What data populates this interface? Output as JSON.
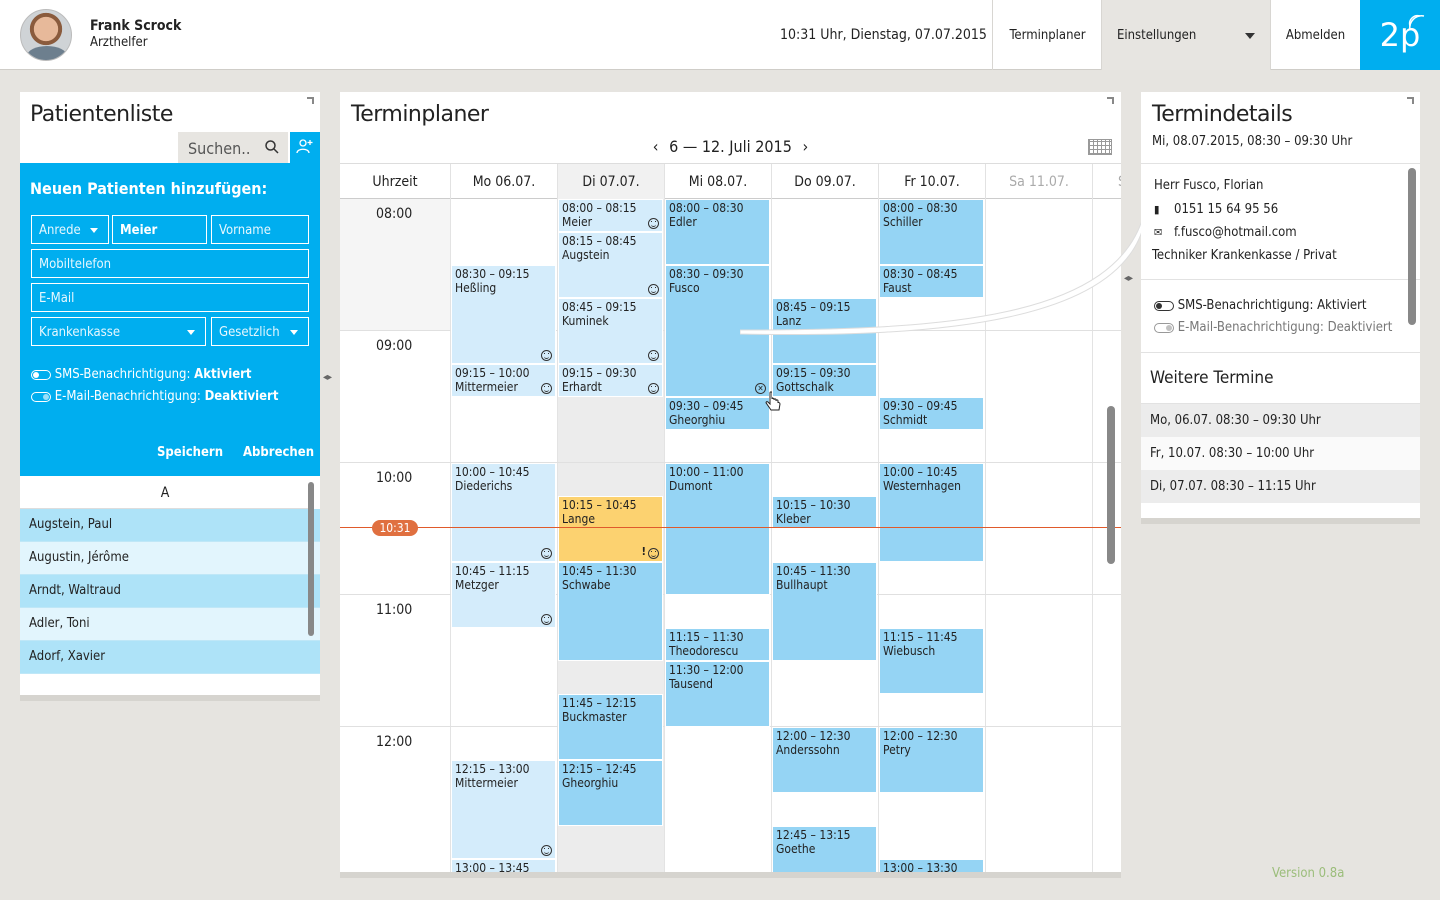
{
  "header": {
    "user_name": "Frank Scrock",
    "user_role": "Arzthelfer",
    "datetime": "10:31 Uhr, Dienstag, 07.07.2015",
    "nav_planner": "Terminplaner",
    "nav_settings": "Einstellungen",
    "nav_logout": "Abmelden",
    "logo": "2p"
  },
  "patient_list": {
    "title": "Patientenliste",
    "search_placeholder": "Suchen..",
    "add_icon": "add-user-icon",
    "form": {
      "title": "Neuen Patienten hinzufügen:",
      "salutation": "Anrede",
      "last_name": "Meier",
      "first_name": "Vorname",
      "mobile": "Mobiltelefon",
      "email": "E-Mail",
      "insurance": "Krankenkasse",
      "insurance_type": "Gesetzlich",
      "sms_label": "SMS-Benachrichtigung:",
      "sms_state": "Aktiviert",
      "email_label": "E-Mail-Benachrichtigung:",
      "email_state": "Deaktiviert",
      "save": "Speichern",
      "cancel": "Abbrechen"
    },
    "letter": "A",
    "patients": [
      "Augstein, Paul",
      "Augustin, Jérôme",
      "Arndt, Waltraud",
      "Adler, Toni",
      "Adorf, Xavier"
    ]
  },
  "planner": {
    "title": "Terminplaner",
    "week_label": "6 — 12. Juli 2015",
    "prev": "‹",
    "next": "›",
    "time_header": "Uhrzeit",
    "days": [
      "Mo 06.07.",
      "Di 07.07.",
      "Mi 08.07.",
      "Do 09.07.",
      "Fr 10.07.",
      "Sa 11.07.",
      "S"
    ],
    "hours": [
      "08:00",
      "09:00",
      "10:00",
      "11:00",
      "12:00"
    ],
    "now": "10:31",
    "appointments": {
      "mo": [
        {
          "time": "08:30 – 09:15",
          "name": "Heßling"
        },
        {
          "time": "09:15 – 10:00",
          "name": "Mittermeier"
        },
        {
          "time": "10:00 – 10:45",
          "name": "Diederichs"
        },
        {
          "time": "10:45 – 11:15",
          "name": "Metzger"
        },
        {
          "time": "12:15 – 13:00",
          "name": "Mittermeier"
        },
        {
          "time": "13:00 – 13:45",
          "name": ""
        }
      ],
      "di": [
        {
          "time": "08:00 – 08:15",
          "name": "Meier"
        },
        {
          "time": "08:15 – 08:45",
          "name": "Augstein"
        },
        {
          "time": "08:45 – 09:15",
          "name": "Kuminek"
        },
        {
          "time": "09:15 – 09:30",
          "name": "Erhardt"
        },
        {
          "time": "10:15 – 10:45",
          "name": "Lange"
        },
        {
          "time": "10:45 – 11:30",
          "name": "Schwabe"
        },
        {
          "time": "11:45 – 12:15",
          "name": "Buckmaster"
        },
        {
          "time": "12:15 – 12:45",
          "name": "Gheorghiu"
        }
      ],
      "mi": [
        {
          "time": "08:00 – 08:30",
          "name": "Edler"
        },
        {
          "time": "08:30 – 09:30",
          "name": "Fusco"
        },
        {
          "time": "09:30 – 09:45",
          "name": "Gheorghiu"
        },
        {
          "time": "10:00 – 11:00",
          "name": "Dumont"
        },
        {
          "time": "11:15 – 11:30",
          "name": "Theodorescu"
        },
        {
          "time": "11:30 – 12:00",
          "name": "Tausend"
        }
      ],
      "do": [
        {
          "time": "08:45 – 09:15",
          "name": "Lanz"
        },
        {
          "time": "09:15 – 09:30",
          "name": "Gottschalk"
        },
        {
          "time": "10:15 – 10:30",
          "name": "Kleber"
        },
        {
          "time": "10:45 – 11:30",
          "name": "Bullhaupt"
        },
        {
          "time": "12:00 – 12:30",
          "name": "Anderssohn"
        },
        {
          "time": "12:45 – 13:15",
          "name": "Goethe"
        }
      ],
      "fr": [
        {
          "time": "08:00 – 08:30",
          "name": "Schiller"
        },
        {
          "time": "08:30 – 08:45",
          "name": "Faust"
        },
        {
          "time": "09:30 – 09:45",
          "name": "Schmidt"
        },
        {
          "time": "10:00 – 10:45",
          "name": "Westernhagen"
        },
        {
          "time": "11:15 – 11:45",
          "name": "Wiebusch"
        },
        {
          "time": "12:00 – 12:30",
          "name": "Petry"
        },
        {
          "time": "13:00 – 13:30",
          "name": ""
        }
      ]
    }
  },
  "details": {
    "title": "Termindetails",
    "when": "Mi, 08.07.2015, 08:30 – 09:30 Uhr",
    "name": "Herr Fusco, Florian",
    "phone": "0151 15 64 95 56",
    "email": "f.fusco@hotmail.com",
    "insurance": "Techniker Krankenkasse / Privat",
    "sms_label": "SMS-Benachrichtigung:",
    "sms_state": "Aktiviert",
    "email_label": "E-Mail-Benachrichtigung:",
    "email_state": "Deaktiviert",
    "further_title": "Weitere Termine",
    "further": [
      "Mo, 06.07. 08:30 – 09:30 Uhr",
      "Fr, 10.07. 08:30 – 10:00 Uhr",
      "Di, 07.07. 08:30 – 11:15 Uhr"
    ]
  },
  "version": "Version 0.8a"
}
